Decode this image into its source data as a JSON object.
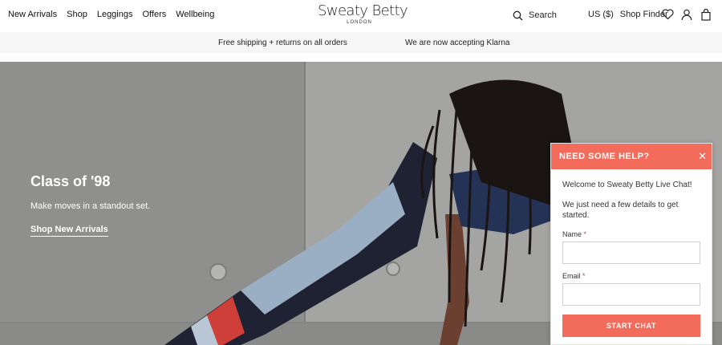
{
  "header": {
    "nav": [
      "New Arrivals",
      "Shop",
      "Leggings",
      "Offers",
      "Wellbeing"
    ],
    "logo": {
      "main": "Sweaty Betty",
      "sub": "LONDON"
    },
    "search_label": "Search",
    "currency": "US ($)",
    "shop_finder": "Shop Finder",
    "icons": [
      "wishlist-heart-icon",
      "account-user-icon",
      "bag-icon"
    ]
  },
  "announcement": {
    "left": "Free shipping + returns on all orders",
    "right": "We are now accepting Klarna"
  },
  "hero": {
    "title": "Class of '98",
    "subtitle": "Make moves in a standout set.",
    "cta": "Shop New Arrivals"
  },
  "chat": {
    "title": "NEED SOME HELP?",
    "welcome": "Welcome to Sweaty Betty Live Chat!",
    "details": "We just need a few details to get started.",
    "name_label": "Name",
    "email_label": "Email",
    "required_mark": "*",
    "button": "START CHAT",
    "accent": "#f26b5b"
  }
}
